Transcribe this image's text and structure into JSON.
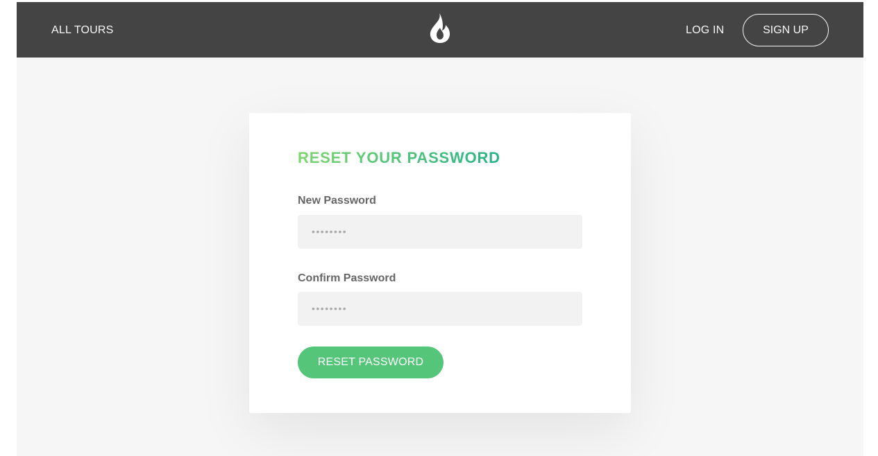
{
  "header": {
    "all_tours_label": "ALL TOURS",
    "login_label": "LOG IN",
    "signup_label": "SIGN UP",
    "logo_icon": "flame-logo-icon",
    "background_color": "#444444"
  },
  "form": {
    "title": "RESET YOUR PASSWORD",
    "title_gradient": [
      "#7dd56f",
      "#28b487"
    ],
    "new_password_label": "New Password",
    "new_password_value": "••••••••",
    "confirm_password_label": "Confirm Password",
    "confirm_password_value": "••••••••",
    "submit_label": "RESET PASSWORD",
    "submit_color": "#55c57a"
  }
}
